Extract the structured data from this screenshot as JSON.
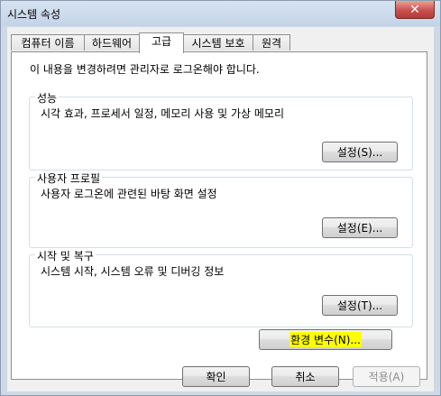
{
  "window": {
    "title": "시스템 속성",
    "close_glyph": "✕"
  },
  "tabs": [
    {
      "label": "컴퓨터 이름",
      "active": false
    },
    {
      "label": "하드웨어",
      "active": false
    },
    {
      "label": "고급",
      "active": true
    },
    {
      "label": "시스템 보호",
      "active": false
    },
    {
      "label": "원격",
      "active": false
    }
  ],
  "advanced": {
    "notice": "이 내용을 변경하려면 관리자로 로그온해야 합니다.",
    "performance": {
      "title": "성능",
      "description": "시각 효과, 프로세서 일정, 메모리 사용 및 가상 메모리",
      "button": "설정(S)..."
    },
    "user_profiles": {
      "title": "사용자 프로필",
      "description": "사용자 로그온에 관련된 바탕 화면 설정",
      "button": "설정(E)..."
    },
    "startup_recovery": {
      "title": "시작 및 복구",
      "description": "시스템 시작, 시스템 오류 및 디버깅 정보",
      "button": "설정(T)..."
    },
    "env_button": "환경 변수(N)..."
  },
  "footer": {
    "ok": "확인",
    "cancel": "취소",
    "apply": "적용(A)"
  },
  "colors": {
    "highlight": "#ffff00",
    "close_button": "#c75050"
  }
}
